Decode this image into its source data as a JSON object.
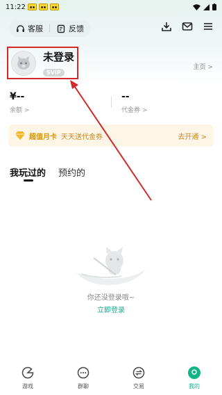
{
  "status_bar": {
    "time": "11:22"
  },
  "top_bar": {
    "service_label": "客服",
    "feedback_label": "反馈"
  },
  "profile": {
    "name": "未登录",
    "badge": "SVIP",
    "home_link": "主页 >"
  },
  "stats": {
    "balance_value": "¥--",
    "balance_label": "余额 >",
    "voucher_value": "--",
    "voucher_label": "代金券 >"
  },
  "monthly_card": {
    "title": "超值月卡",
    "subtitle": "天天送代金券",
    "action": "去开通 >"
  },
  "tabs": [
    {
      "label": "我玩过的",
      "active": true
    },
    {
      "label": "预约的",
      "active": false
    }
  ],
  "empty_state": {
    "message": "你还没登录哦~",
    "login_link": "立即登录"
  },
  "bottom_nav": [
    {
      "label": "游戏",
      "icon": "game-icon",
      "active": false
    },
    {
      "label": "群聊",
      "icon": "chat-icon",
      "active": false
    },
    {
      "label": "交易",
      "icon": "trade-icon",
      "active": false
    },
    {
      "label": "我的",
      "icon": "profile-icon",
      "active": true
    }
  ],
  "colors": {
    "accent": "#11b389",
    "highlight_box": "#d12a2a",
    "card_text": "#d8950c"
  }
}
